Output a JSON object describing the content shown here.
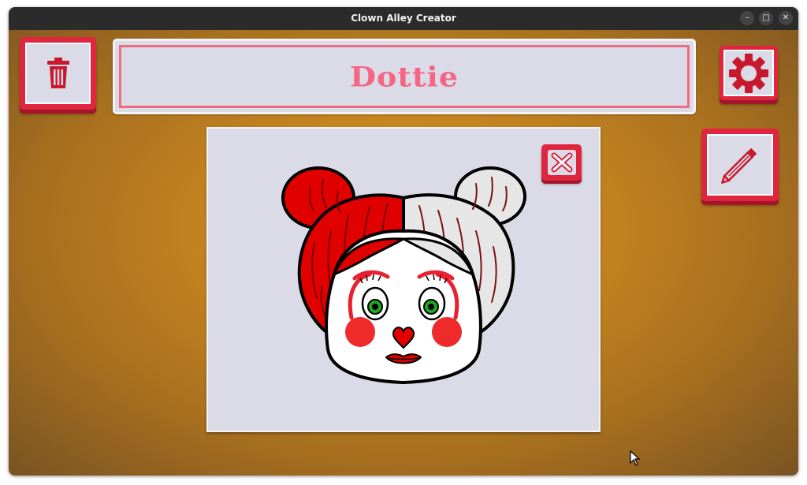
{
  "window": {
    "title": "Clown Alley Creator",
    "controls": {
      "minimize_icon": "–",
      "maximize_icon": "□",
      "close_icon": "✕"
    }
  },
  "toolbar": {
    "delete_icon": "trash-icon",
    "settings_icon": "gear-icon",
    "edit_icon": "pencil-icon"
  },
  "clown": {
    "name": "Dottie",
    "hair_left_color": "#e00000",
    "hair_right_color": "#e6e6e6",
    "eye_color": "#1fa81f",
    "accent_color": "#e8202f"
  },
  "portrait": {
    "close_icon": "close-x-icon"
  },
  "theme": {
    "accent": "#e0253f",
    "name_color": "#f56684",
    "panel_bg": "#dadbe6",
    "background": "#c8861f"
  }
}
